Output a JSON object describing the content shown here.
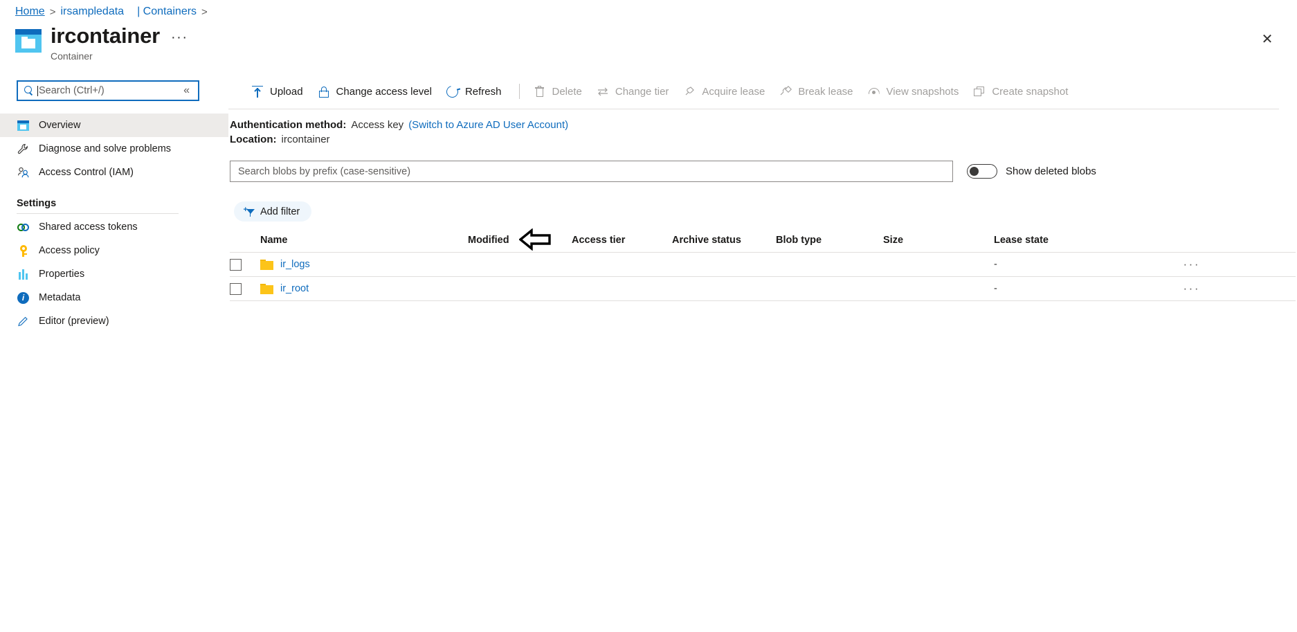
{
  "breadcrumb": {
    "home": "Home",
    "account": "irsampledata",
    "containers": "| Containers",
    "sep": ">"
  },
  "header": {
    "title": "ircontainer",
    "subtitle": "Container",
    "more_label": "···",
    "close_label": "✕",
    "icon": "container-icon"
  },
  "sidebar": {
    "search": {
      "placeholder": "Search (Ctrl+/)",
      "value": "",
      "icon": "search-icon"
    },
    "collapse_label": "«",
    "items": [
      {
        "label": "Overview",
        "icon": "overview-icon",
        "active": true
      },
      {
        "label": "Diagnose and solve problems",
        "icon": "wrench-icon",
        "active": false
      },
      {
        "label": "Access Control (IAM)",
        "icon": "people-icon",
        "active": false
      }
    ],
    "group_title": "Settings",
    "settings_items": [
      {
        "label": "Shared access tokens",
        "icon": "link-rings-icon"
      },
      {
        "label": "Access policy",
        "icon": "key-icon"
      },
      {
        "label": "Properties",
        "icon": "bars-icon"
      },
      {
        "label": "Metadata",
        "icon": "info-icon"
      },
      {
        "label": "Editor (preview)",
        "icon": "pencil-icon"
      }
    ]
  },
  "toolbar": {
    "buttons": [
      {
        "label": "Upload",
        "icon": "upload-icon",
        "disabled": false
      },
      {
        "label": "Change access level",
        "icon": "lock-icon",
        "disabled": false
      },
      {
        "label": "Refresh",
        "icon": "refresh-icon",
        "disabled": false
      },
      {
        "label": "Delete",
        "icon": "trash-icon",
        "disabled": true
      },
      {
        "label": "Change tier",
        "icon": "swap-icon",
        "disabled": true
      },
      {
        "label": "Acquire lease",
        "icon": "plug-icon",
        "disabled": true
      },
      {
        "label": "Break lease",
        "icon": "plug-broken-icon",
        "disabled": true
      },
      {
        "label": "View snapshots",
        "icon": "eye-icon",
        "disabled": true
      },
      {
        "label": "Create snapshot",
        "icon": "copy-icon",
        "disabled": true
      }
    ]
  },
  "info": {
    "auth_label": "Authentication method:",
    "auth_value": "Access key",
    "auth_link": "(Switch to Azure AD User Account)",
    "location_label": "Location:",
    "location_value": "ircontainer"
  },
  "filters": {
    "search_placeholder": "Search blobs by prefix (case-sensitive)",
    "search_value": "",
    "toggle_label": "Show deleted blobs",
    "toggle_on": false,
    "add_filter_label": "Add filter",
    "add_filter_icon": "add-filter-icon"
  },
  "table": {
    "columns": [
      "Name",
      "Modified",
      "Access tier",
      "Archive status",
      "Blob type",
      "Size",
      "Lease state"
    ],
    "rows": [
      {
        "name": "ir_logs",
        "icon": "folder-icon",
        "modified": "",
        "access_tier": "",
        "archive_status": "",
        "blob_type": "",
        "size": "",
        "lease_state": "-",
        "menu": "···",
        "checked": false
      },
      {
        "name": "ir_root",
        "icon": "folder-icon",
        "modified": "",
        "access_tier": "",
        "archive_status": "",
        "blob_type": "",
        "size": "",
        "lease_state": "-",
        "menu": "···",
        "checked": false
      }
    ]
  },
  "annotation": {
    "arrow": "left-pointing-arrow",
    "target_row": "ir_logs"
  },
  "colors": {
    "accent": "#0f6cbd",
    "link": "#0f6cbd",
    "folder": "#fcc419",
    "active_nav_bg": "#edebe9",
    "disabled_text": "#a19f9d"
  }
}
